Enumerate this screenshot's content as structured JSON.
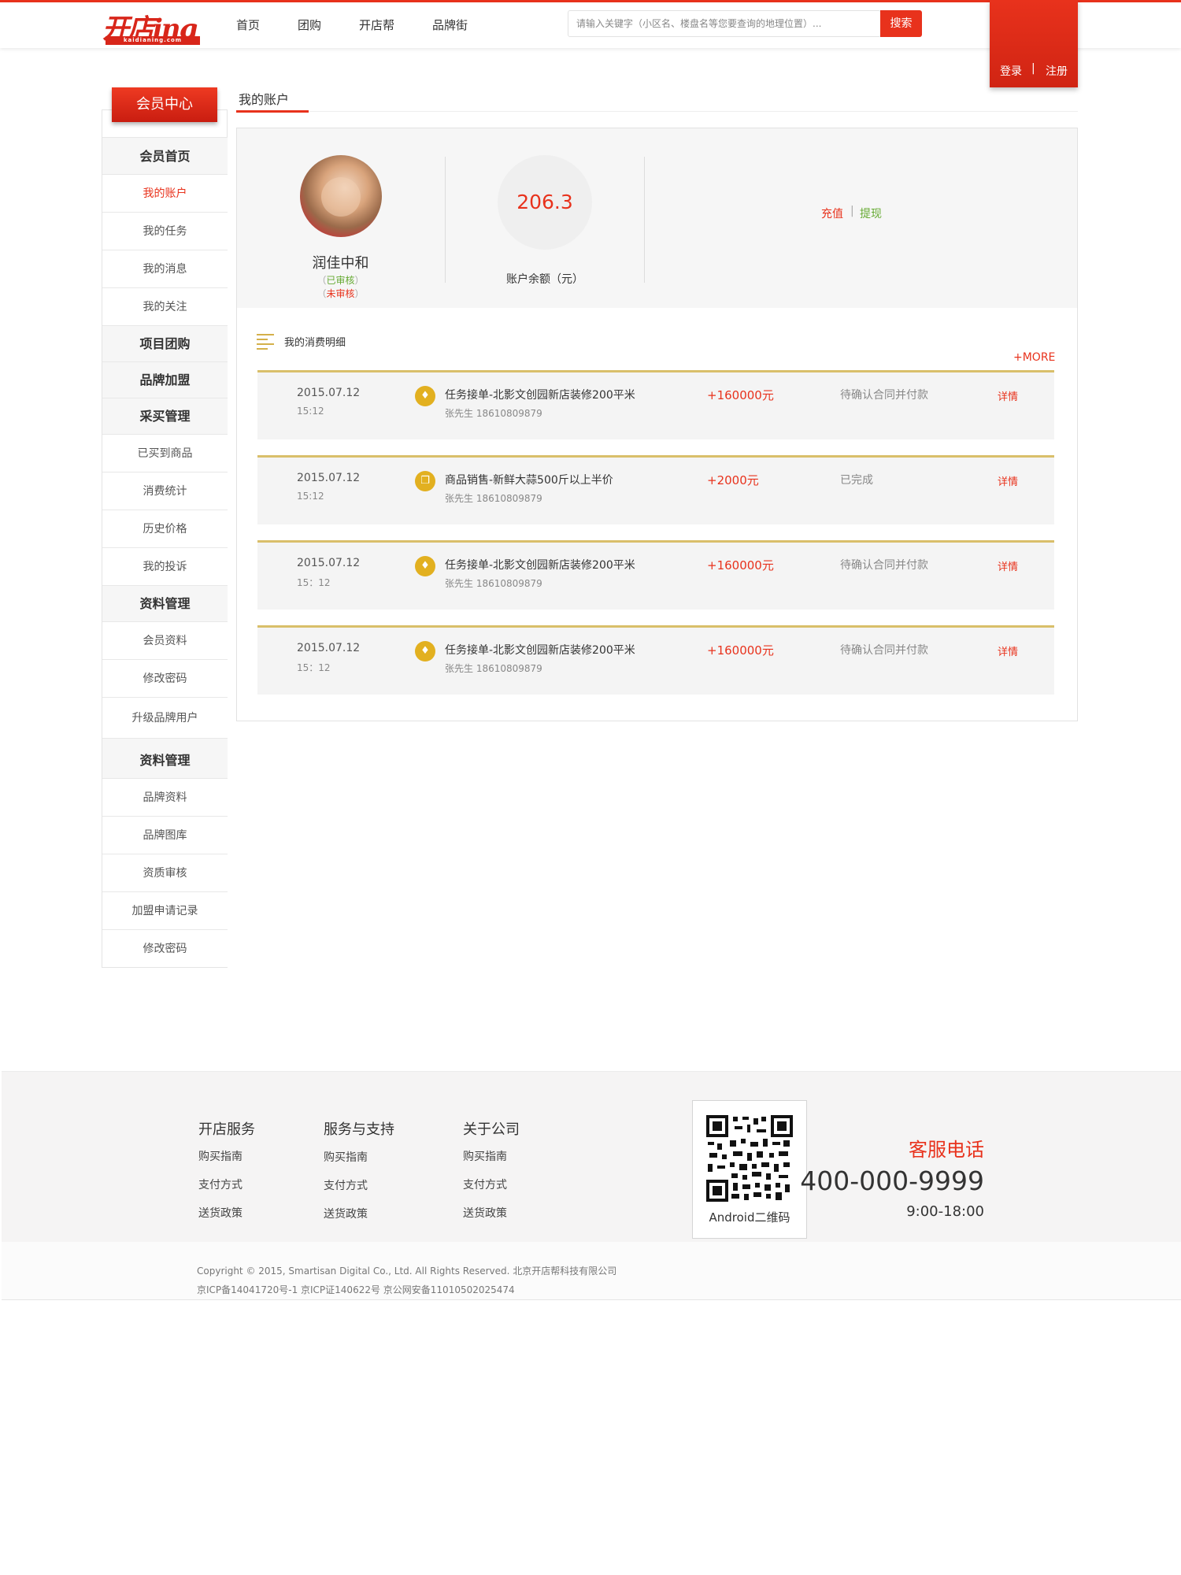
{
  "header": {
    "logo_text": "开店ing",
    "logo_sub": "kaidianing.com",
    "nav": [
      "首页",
      "团购",
      "开店帮",
      "品牌街"
    ],
    "search_placeholder": "请输入关键字（小区名、楼盘名等您要查询的地理位置）...",
    "search_button": "搜索",
    "login": "登录",
    "separator": "|",
    "register": "注册",
    "accent_color": "#e8321c"
  },
  "sidebar": {
    "member_center": "会员中心",
    "items": [
      {
        "label": "会员首页",
        "kind": "head"
      },
      {
        "label": "我的账户",
        "kind": "sub",
        "active": true
      },
      {
        "label": "我的任务",
        "kind": "sub"
      },
      {
        "label": "我的消息",
        "kind": "sub"
      },
      {
        "label": "我的关注",
        "kind": "sub"
      },
      {
        "label": "项目团购",
        "kind": "head"
      },
      {
        "label": "品牌加盟",
        "kind": "head"
      },
      {
        "label": "采买管理",
        "kind": "head"
      },
      {
        "label": "已买到商品",
        "kind": "sub"
      },
      {
        "label": "消费统计",
        "kind": "sub"
      },
      {
        "label": "历史价格",
        "kind": "sub"
      },
      {
        "label": "我的投诉",
        "kind": "sub"
      },
      {
        "label": "资料管理",
        "kind": "head"
      },
      {
        "label": "会员资料",
        "kind": "sub"
      },
      {
        "label": "修改密码",
        "kind": "sub"
      },
      {
        "label": "升级品牌用户",
        "kind": "sub"
      },
      {
        "label": "资料管理",
        "kind": "head"
      },
      {
        "label": "品牌资料",
        "kind": "sub"
      },
      {
        "label": "品牌图库",
        "kind": "sub"
      },
      {
        "label": "资质审核",
        "kind": "sub"
      },
      {
        "label": "加盟申请记录",
        "kind": "sub"
      },
      {
        "label": "修改密码",
        "kind": "sub"
      }
    ]
  },
  "account": {
    "tab_title": "我的账户",
    "user_name": "润佳中和",
    "status_open": "（",
    "status_verified": "已审核",
    "status_close": "）",
    "status_unverified": "未审核",
    "balance": "206.3",
    "balance_label": "账户余额（元）",
    "recharge": "充值",
    "divider": "|",
    "withdraw": "提现"
  },
  "records": {
    "title": "我的消费明细",
    "more": "+MORE",
    "items": [
      {
        "date": "2015.07.12",
        "time": "15:12",
        "icon": "tag-icon",
        "title": "任务接单-北影文创园新店装修200平米",
        "person": "张先生  18610809879",
        "amount": "+160000元",
        "status": "待确认合同并付款",
        "detail": "详情"
      },
      {
        "date": "2015.07.12",
        "time": "15:12",
        "icon": "goods-icon",
        "title": "商品销售-新鲜大蒜500斤以上半价",
        "person": "张先生  18610809879",
        "amount": "+2000元",
        "status": "已完成",
        "detail": "详情"
      },
      {
        "date": "2015.07.12",
        "time": "15：12",
        "icon": "tag-icon",
        "title": "任务接单-北影文创园新店装修200平米",
        "person": "张先生  18610809879",
        "amount": "+160000元",
        "status": "待确认合同并付款",
        "detail": "详情"
      },
      {
        "date": "2015.07.12",
        "time": "15：12",
        "icon": "tag-icon",
        "title": "任务接单-北影文创园新店装修200平米",
        "person": "张先生  18610809879",
        "amount": "+160000元",
        "status": "待确认合同并付款",
        "detail": "详情"
      }
    ]
  },
  "footer": {
    "columns": [
      {
        "title": "开店服务",
        "links": [
          "购买指南",
          "支付方式",
          "送货政策"
        ]
      },
      {
        "title": "服务与支持",
        "links": [
          "购买指南",
          "支付方式",
          "送货政策"
        ]
      },
      {
        "title": "关于公司",
        "links": [
          "购买指南",
          "支付方式",
          "送货政策"
        ]
      }
    ],
    "qr_label": "Android二维码",
    "service_title": "客服电话",
    "service_phone": "400-000-9999",
    "service_hours": "9:00-18:00",
    "copyright_line1": "Copyright © 2015, Smartisan Digital Co., Ltd. All Rights Reserved. 北京开店帮科技有限公司",
    "copyright_line2": "京ICP备14041720号-1 京ICP证140622号 京公网安备11010502025474"
  }
}
